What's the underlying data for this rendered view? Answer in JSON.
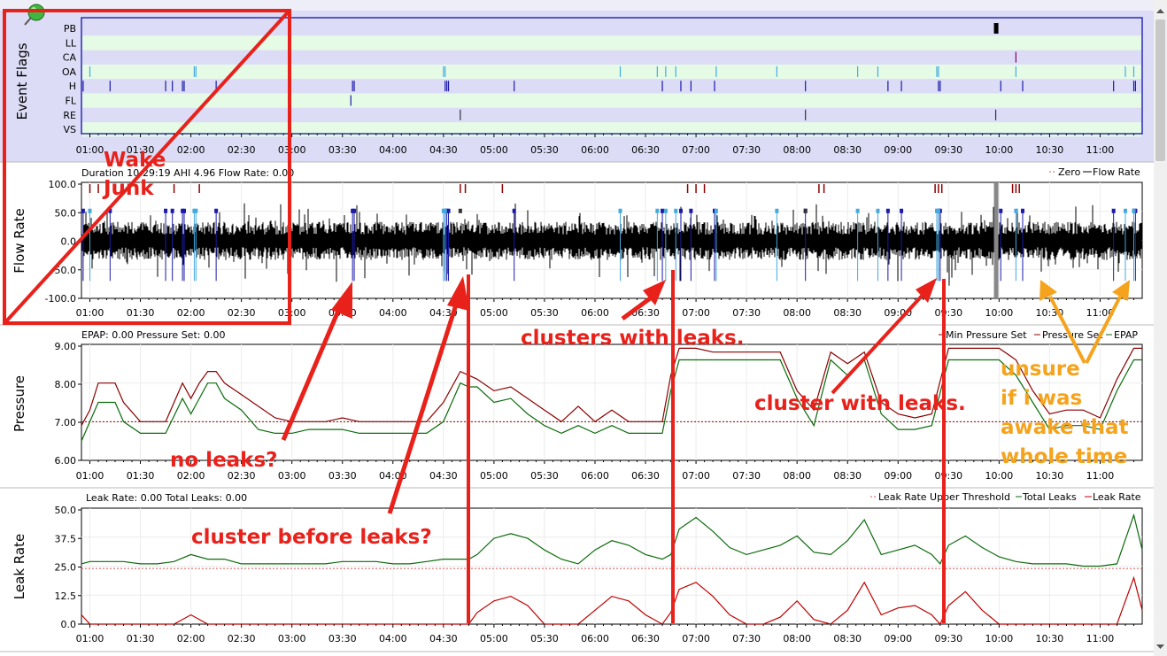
{
  "x_ticks": [
    "01:00",
    "01:30",
    "02:00",
    "02:30",
    "03:00",
    "03:30",
    "04:00",
    "04:30",
    "05:00",
    "05:30",
    "06:00",
    "06:30",
    "07:00",
    "07:30",
    "08:00",
    "08:30",
    "09:00",
    "09:30",
    "10:00",
    "10:30",
    "11:00"
  ],
  "panels": {
    "event_flags": {
      "ylabel": "Event Flags",
      "rows": [
        "PB",
        "LL",
        "CA",
        "OA",
        "H",
        "FL",
        "RE",
        "VS"
      ]
    },
    "flow": {
      "ylabel": "Flow Rate",
      "header": "Duration 10:29:19 AHI 4.96 Flow Rate: 0.00",
      "legend": "Zero Flow Rate",
      "legend_items": [
        "Zero",
        "Flow Rate"
      ],
      "yticks": [
        "100.0",
        "50.0",
        "0.0",
        "-50.0",
        "-100.0"
      ]
    },
    "pressure": {
      "ylabel": "Pressure",
      "header": "EPAP: 0.00 Pressure Set: 0.00",
      "legend_items": [
        "Min Pressure Set",
        "Pressure Set",
        "EPAP"
      ],
      "yticks": [
        "9.00",
        "8.00",
        "7.00",
        "6.00"
      ]
    },
    "leak": {
      "ylabel": "Leak Rate",
      "header": "Leak Rate: 0.00 Total Leaks: 0.00",
      "legend_items": [
        "Leak Rate Upper Threshold",
        "Total Leaks",
        "Leak Rate"
      ],
      "yticks": [
        "50.0",
        "37.5",
        "25.0",
        "12.5",
        "0.0"
      ]
    }
  },
  "annotations": {
    "wake_junk": "Wake Junk",
    "wake": "Wake",
    "junk": "Junk",
    "no_leaks": "no leaks?",
    "cluster_before": "cluster before leaks?",
    "clusters_with": "clusters with leaks.",
    "cluster_with": "cluster with leaks.",
    "unsure": "unsure if i was awake that whole time",
    "unsure_lines": [
      "unsure",
      "if i was",
      "awake that",
      "whole time"
    ]
  },
  "colors": {
    "annotation_red": "#e8211b",
    "annotation_orange": "#f5a31c",
    "flow_trace": "#000000",
    "pressure_set": "#8b0000",
    "epap": "#0b6b0b",
    "total_leaks": "#0b6b0b",
    "leak_rate": "#c00000",
    "threshold": "#e05050",
    "hypopnea": "#1a1aaa",
    "obstructive": "#44aadd",
    "rera": "#333333",
    "central": "#800060",
    "periodic": "#000000",
    "flag_row": "#e6fbe6"
  },
  "chart_data": [
    {
      "type": "events",
      "name": "Event Flags",
      "x_range": [
        "00:55",
        "11:25"
      ],
      "rows": [
        "PB",
        "LL",
        "CA",
        "OA",
        "H",
        "FL",
        "RE",
        "VS"
      ],
      "events": {
        "PB": [
          "09:58"
        ],
        "CA": [
          "10:10"
        ],
        "OA": [
          "01:00",
          "02:02",
          "02:03",
          "04:30",
          "04:31",
          "06:15",
          "06:37",
          "06:42",
          "06:48",
          "07:12",
          "07:48",
          "08:36",
          "08:48",
          "09:23",
          "09:24",
          "10:10",
          "11:15",
          "11:20"
        ],
        "H": [
          "00:56",
          "01:12",
          "01:45",
          "01:49",
          "01:55",
          "01:56",
          "02:15",
          "03:36",
          "03:37",
          "04:31",
          "04:32",
          "04:33",
          "05:12",
          "06:40",
          "06:51",
          "06:57",
          "07:11",
          "08:05",
          "08:54",
          "09:02",
          "09:24",
          "09:25",
          "10:01",
          "10:14",
          "11:08",
          "11:20",
          "11:21"
        ],
        "FL": [
          "03:35"
        ],
        "RE": [
          "04:40",
          "08:05",
          "09:58"
        ]
      }
    },
    {
      "type": "line",
      "name": "Flow Rate",
      "x_range": [
        "00:55",
        "11:25"
      ],
      "ylim": [
        -100,
        100
      ],
      "yticks": [
        100,
        50,
        0,
        -50,
        -100
      ],
      "series": [
        {
          "name": "Flow Rate",
          "band": {
            "typical_min": -30,
            "typical_max": 25
          }
        }
      ]
    },
    {
      "type": "line",
      "name": "Pressure",
      "x_range": [
        "00:55",
        "11:25"
      ],
      "ylim": [
        6,
        9
      ],
      "yticks": [
        9,
        8,
        7,
        6
      ],
      "min_pressure_set": 7.0,
      "series": [
        {
          "name": "Pressure Set",
          "x": [
            "00:55",
            "01:00",
            "01:05",
            "01:15",
            "01:20",
            "01:30",
            "01:40",
            "01:45",
            "01:55",
            "02:00",
            "02:05",
            "02:10",
            "02:15",
            "02:20",
            "02:30",
            "02:40",
            "02:50",
            "03:00",
            "03:10",
            "03:15",
            "03:20",
            "03:30",
            "03:40",
            "03:50",
            "04:00",
            "04:10",
            "04:20",
            "04:30",
            "04:40",
            "04:45",
            "04:50",
            "05:00",
            "05:10",
            "05:20",
            "05:30",
            "05:40",
            "05:50",
            "06:00",
            "06:10",
            "06:20",
            "06:30",
            "06:40",
            "06:45",
            "06:50",
            "07:00",
            "07:10",
            "07:20",
            "07:30",
            "07:40",
            "07:50",
            "08:00",
            "08:10",
            "08:20",
            "08:30",
            "08:40",
            "08:50",
            "09:00",
            "09:10",
            "09:20",
            "09:30",
            "09:40",
            "09:50",
            "10:00",
            "10:10",
            "10:20",
            "10:30",
            "10:40",
            "10:50",
            "11:00",
            "11:10",
            "11:20",
            "11:25"
          ],
          "values": [
            6.9,
            7.3,
            8.0,
            8.0,
            7.5,
            7.0,
            7.0,
            7.0,
            8.0,
            7.6,
            8.0,
            8.3,
            8.3,
            8.0,
            7.7,
            7.4,
            7.1,
            7.0,
            7.0,
            7.0,
            7.0,
            7.1,
            7.0,
            7.0,
            7.0,
            7.0,
            7.0,
            7.5,
            8.3,
            8.2,
            8.1,
            7.8,
            7.9,
            7.6,
            7.3,
            7.0,
            7.4,
            7.0,
            7.3,
            7.0,
            7.0,
            7.0,
            8.2,
            8.9,
            8.9,
            8.8,
            8.8,
            8.8,
            8.8,
            8.8,
            7.8,
            7.3,
            8.8,
            8.5,
            8.8,
            7.5,
            7.2,
            7.1,
            7.2,
            8.9,
            8.9,
            8.9,
            8.9,
            8.6,
            7.8,
            7.2,
            7.3,
            7.3,
            7.1,
            8.1,
            8.9,
            8.9
          ]
        },
        {
          "name": "EPAP",
          "x": [
            "00:55",
            "01:00",
            "01:05",
            "01:15",
            "01:20",
            "01:30",
            "01:40",
            "01:45",
            "01:55",
            "02:00",
            "02:05",
            "02:10",
            "02:15",
            "02:20",
            "02:30",
            "02:40",
            "02:50",
            "03:00",
            "03:10",
            "03:15",
            "03:20",
            "03:30",
            "03:40",
            "03:50",
            "04:00",
            "04:10",
            "04:20",
            "04:30",
            "04:40",
            "04:45",
            "04:50",
            "05:00",
            "05:10",
            "05:20",
            "05:30",
            "05:40",
            "05:50",
            "06:00",
            "06:10",
            "06:20",
            "06:30",
            "06:40",
            "06:45",
            "06:50",
            "07:00",
            "07:10",
            "07:20",
            "07:30",
            "07:40",
            "07:50",
            "08:00",
            "08:10",
            "08:20",
            "08:30",
            "08:40",
            "08:50",
            "09:00",
            "09:10",
            "09:20",
            "09:30",
            "09:40",
            "09:50",
            "10:00",
            "10:10",
            "10:20",
            "10:30",
            "10:40",
            "10:50",
            "11:00",
            "11:10",
            "11:20",
            "11:25"
          ],
          "values": [
            6.5,
            7.0,
            7.5,
            7.5,
            7.0,
            6.7,
            6.7,
            6.7,
            7.6,
            7.2,
            7.6,
            8.0,
            8.0,
            7.6,
            7.3,
            6.8,
            6.7,
            6.7,
            6.8,
            6.8,
            6.8,
            6.8,
            6.7,
            6.7,
            6.7,
            6.7,
            6.7,
            7.0,
            8.0,
            7.9,
            7.9,
            7.5,
            7.6,
            7.2,
            6.9,
            6.7,
            6.9,
            6.7,
            6.9,
            6.7,
            6.7,
            6.7,
            7.8,
            8.6,
            8.6,
            8.6,
            8.6,
            8.6,
            8.6,
            8.6,
            7.6,
            6.9,
            8.6,
            8.2,
            8.6,
            7.2,
            6.8,
            6.8,
            6.9,
            8.6,
            8.6,
            8.6,
            8.6,
            8.2,
            7.5,
            6.8,
            6.9,
            6.9,
            6.8,
            7.8,
            8.6,
            8.6
          ]
        }
      ]
    },
    {
      "type": "line",
      "name": "Leak Rate",
      "x_range": [
        "00:55",
        "11:25"
      ],
      "ylim": [
        0,
        50
      ],
      "yticks": [
        50,
        37.5,
        25,
        12.5,
        0
      ],
      "upper_threshold": 24,
      "series": [
        {
          "name": "Total Leaks",
          "x": [
            "00:55",
            "01:00",
            "01:10",
            "01:20",
            "01:30",
            "01:40",
            "01:50",
            "02:00",
            "02:10",
            "02:20",
            "02:30",
            "02:40",
            "02:50",
            "03:00",
            "03:10",
            "03:20",
            "03:30",
            "03:40",
            "03:50",
            "04:00",
            "04:10",
            "04:20",
            "04:30",
            "04:40",
            "04:45",
            "04:50",
            "05:00",
            "05:10",
            "05:20",
            "05:30",
            "05:40",
            "05:50",
            "06:00",
            "06:10",
            "06:20",
            "06:30",
            "06:40",
            "06:45",
            "06:50",
            "07:00",
            "07:10",
            "07:20",
            "07:30",
            "07:40",
            "07:50",
            "08:00",
            "08:10",
            "08:20",
            "08:30",
            "08:40",
            "08:50",
            "09:00",
            "09:10",
            "09:20",
            "09:25",
            "09:30",
            "09:40",
            "09:50",
            "10:00",
            "10:10",
            "10:20",
            "10:30",
            "10:40",
            "10:50",
            "11:00",
            "11:10",
            "11:20",
            "11:25"
          ],
          "values": [
            26,
            27,
            27,
            27,
            26,
            26,
            27,
            30,
            28,
            28,
            26,
            26,
            26,
            26,
            26,
            26,
            27,
            27,
            27,
            26,
            26,
            27,
            28,
            28,
            28,
            30,
            37,
            39,
            37,
            32,
            28,
            26,
            32,
            36,
            34,
            30,
            28,
            30,
            41,
            46,
            40,
            33,
            30,
            32,
            34,
            38,
            31,
            30,
            36,
            45,
            30,
            32,
            34,
            30,
            26,
            34,
            38,
            33,
            29,
            27,
            26,
            26,
            26,
            25,
            25,
            26,
            47,
            32
          ]
        },
        {
          "name": "Leak Rate",
          "x": [
            "00:55",
            "01:00",
            "01:10",
            "01:20",
            "01:30",
            "01:40",
            "01:50",
            "02:00",
            "02:10",
            "02:20",
            "02:30",
            "02:40",
            "02:50",
            "03:00",
            "03:10",
            "03:20",
            "03:30",
            "03:40",
            "03:50",
            "04:00",
            "04:10",
            "04:20",
            "04:30",
            "04:40",
            "04:45",
            "04:50",
            "05:00",
            "05:10",
            "05:20",
            "05:30",
            "05:40",
            "05:50",
            "06:00",
            "06:10",
            "06:20",
            "06:30",
            "06:40",
            "06:45",
            "06:50",
            "07:00",
            "07:10",
            "07:20",
            "07:30",
            "07:40",
            "07:50",
            "08:00",
            "08:10",
            "08:20",
            "08:30",
            "08:40",
            "08:50",
            "09:00",
            "09:10",
            "09:20",
            "09:25",
            "09:30",
            "09:40",
            "09:50",
            "10:00",
            "10:10",
            "10:20",
            "10:30",
            "10:40",
            "10:50",
            "11:00",
            "11:10",
            "11:20",
            "11:25"
          ],
          "values": [
            4,
            0,
            0,
            0,
            0,
            0,
            0,
            4,
            0,
            0,
            0,
            0,
            0,
            0,
            0,
            0,
            0,
            0,
            0,
            0,
            0,
            0,
            0,
            0,
            0,
            5,
            10,
            12,
            8,
            0,
            0,
            0,
            6,
            12,
            10,
            4,
            0,
            5,
            15,
            18,
            12,
            4,
            0,
            0,
            3,
            10,
            2,
            0,
            6,
            18,
            4,
            7,
            8,
            4,
            0,
            8,
            14,
            6,
            0,
            0,
            0,
            0,
            0,
            0,
            0,
            0,
            20,
            6
          ]
        }
      ]
    }
  ]
}
